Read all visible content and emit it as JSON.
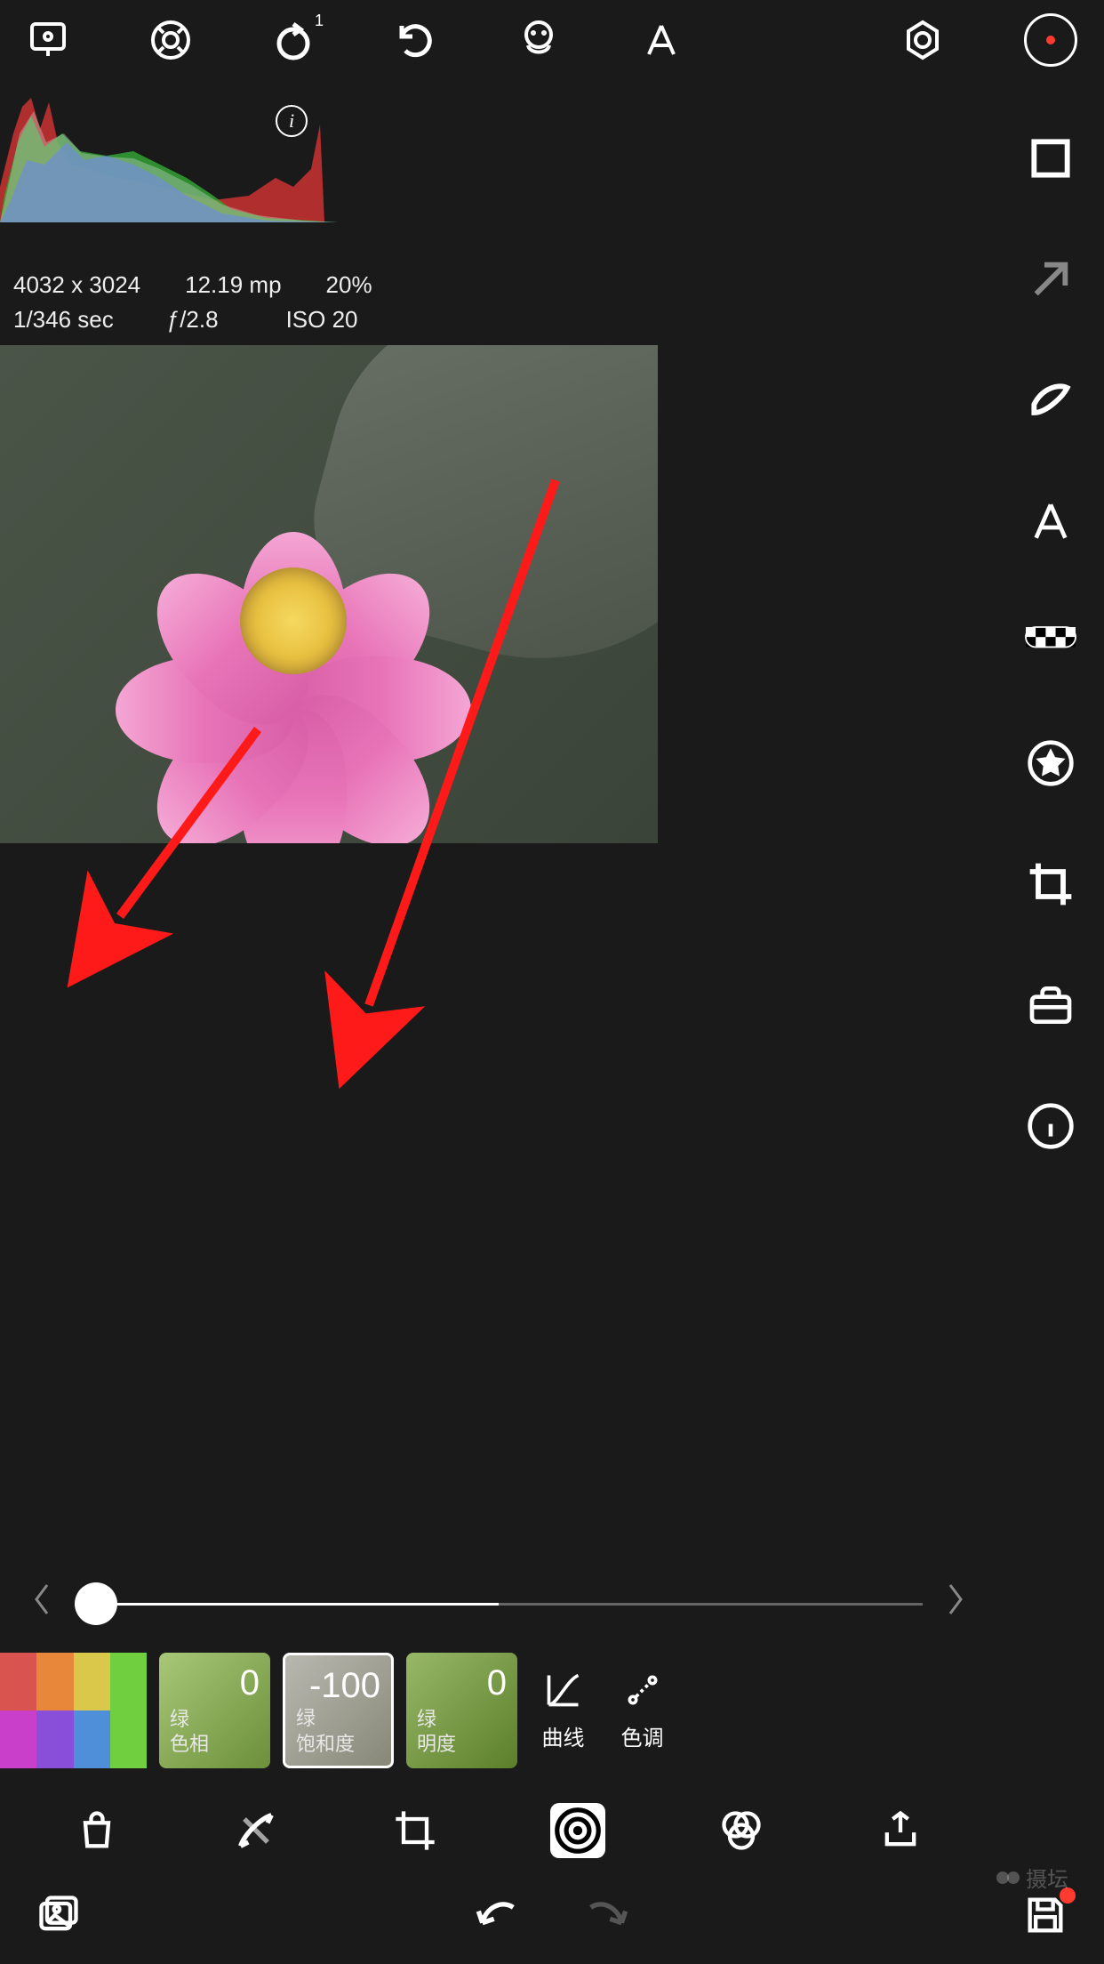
{
  "topbar": {
    "rewind_badge": "1"
  },
  "meta": {
    "dims": "4032 x 3024",
    "mp": "12.19 mp",
    "zoom": "20%",
    "shutter": "1/346 sec",
    "aperture": "ƒ/2.8",
    "iso": "ISO 20"
  },
  "slider": {
    "value": -100
  },
  "tiles": {
    "color_channel": "绿",
    "hue": {
      "label_top": "绿",
      "label_bottom": "色相",
      "value": "0"
    },
    "saturation": {
      "label_top": "绿",
      "label_bottom": "饱和度",
      "value": "-100"
    },
    "luminance": {
      "label_top": "绿",
      "label_bottom": "明度",
      "value": "0"
    },
    "curves": "曲线",
    "tone": "色调"
  },
  "watermark": "摄坛"
}
